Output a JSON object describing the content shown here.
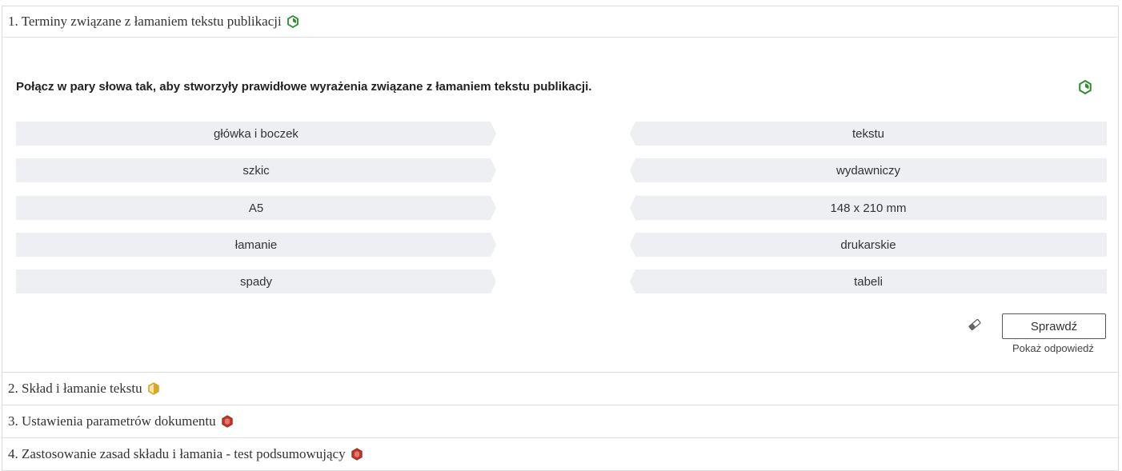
{
  "sections": [
    {
      "title": "1. Terminy związane z łamaniem tekstu publikacji",
      "status": "completed",
      "status_icon": "hexagon-check-icon",
      "color": "#2e8b2e"
    },
    {
      "title": "2. Skład i łamanie tekstu",
      "status": "partial",
      "status_icon": "hexagon-half-icon",
      "color": "#d4a82a"
    },
    {
      "title": "3. Ustawienia parametrów dokumentu",
      "status": "not-started",
      "status_icon": "hexagon-filled-icon",
      "color": "#c0392b"
    },
    {
      "title": "4. Zastosowanie zasad składu i łamania - test podsumowujący",
      "status": "not-started",
      "status_icon": "hexagon-filled-icon",
      "color": "#c0392b"
    }
  ],
  "exercise": {
    "instruction": "Połącz w pary słowa tak, aby stworzyły prawidłowe wyrażenia związane z łamaniem tekstu publikacji.",
    "left_items": [
      "główka i boczek",
      "szkic",
      "A5",
      "łamanie",
      "spady"
    ],
    "right_items": [
      "tekstu",
      "wydawniczy",
      "148 x 210 mm",
      "drukarskie",
      "tabeli"
    ],
    "check_label": "Sprawdź",
    "show_answer_label": "Pokaż odpowiedź"
  }
}
